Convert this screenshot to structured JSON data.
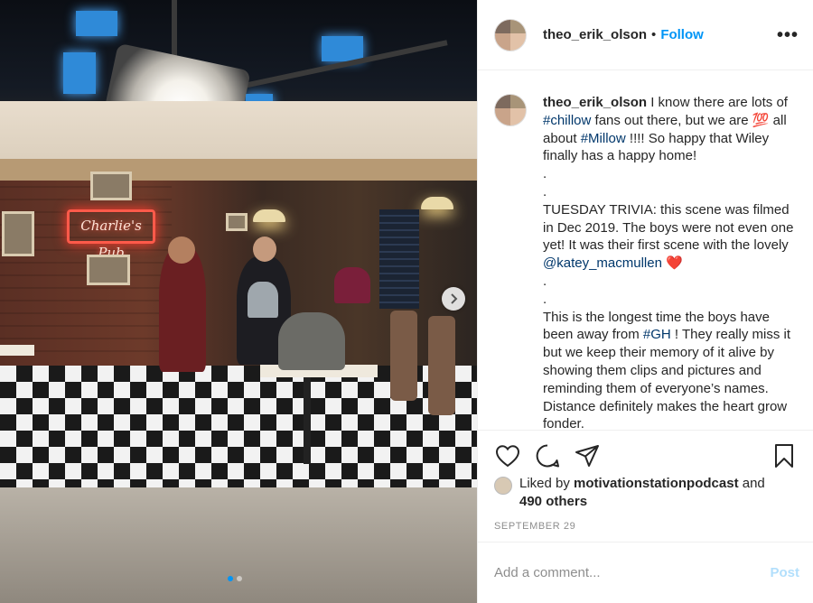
{
  "post": {
    "username": "theo_erik_olson",
    "follow_label": "Follow",
    "more_label": "•••",
    "photo_sign_text": "Charlie's Pub",
    "carousel": {
      "count": 2,
      "active_index": 0
    }
  },
  "caption": {
    "username": "theo_erik_olson",
    "line1_pre": " I know there are lots of ",
    "tag_chillow": "#chillow",
    "line1_post": " fans out there, but we are ",
    "emoji_100": "💯",
    "line2_pre": " all about ",
    "tag_millow": "#Millow",
    "line2_post": " !!!! So happy that Wiley finally has a happy home!",
    "dot1": ".",
    "dot2": ".",
    "trivia_pre": "TUESDAY TRIVIA: this scene was filmed in Dec 2019. The boys were not even one yet! It was their first scene with the lovely ",
    "mention_katey": "@katey_macmullen",
    "heart": " ❤️",
    "dot3": ".",
    "dot4": ".",
    "longest_pre": "This is the longest time the boys have been away from ",
    "tag_gh": "#GH",
    "longest_post": " ! They really miss it but we keep their memory of it alive by showing them clips and pictures and reminding them of everyone’s names. Distance definitely makes the heart grow fonder."
  },
  "likes": {
    "prefix": "Liked by ",
    "liker": "motivationstationpodcast",
    "and": " and",
    "others": "490 others"
  },
  "date": "SEPTEMBER 29",
  "comment": {
    "placeholder": "Add a comment...",
    "post_label": "Post"
  },
  "colors": {
    "link": "#0095f6",
    "hashtag": "#00376b",
    "post_disabled": "#b2dffc",
    "muted": "#8e8e8e"
  },
  "icons": [
    "heart-icon",
    "comment-icon",
    "share-icon",
    "bookmark-icon",
    "chevron-right-icon",
    "more-icon"
  ]
}
